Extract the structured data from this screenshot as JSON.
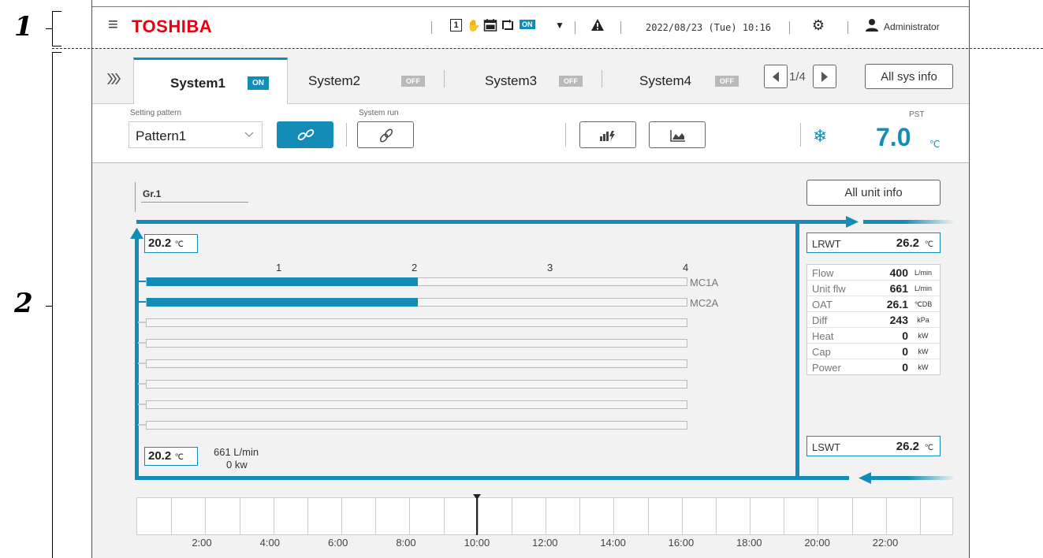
{
  "callouts": {
    "one": "1",
    "two": "2"
  },
  "header": {
    "brand": "TOSHIBA",
    "on_badge": "ON",
    "datetime": "2022/08/23 (Tue) 10:16",
    "user": "Administrator",
    "icons": [
      "menu-icon",
      "schedule-1-icon",
      "hand-icon",
      "calendar-off-icon",
      "cycle-icon",
      "dropdown-icon",
      "warning-icon",
      "gear-icon",
      "user-icon"
    ]
  },
  "tabs": [
    {
      "label": "System1",
      "status": "ON"
    },
    {
      "label": "System2",
      "status": "OFF"
    },
    {
      "label": "System3",
      "status": "OFF"
    },
    {
      "label": "System4",
      "status": "OFF"
    }
  ],
  "pager": {
    "text": "1/4"
  },
  "all_sys_info": "All sys info",
  "toolbar": {
    "setting_pattern_label": "Setting pattern",
    "setting_pattern_value": "Pattern1",
    "system_run_label": "System run",
    "pst_label": "PST",
    "pst_value": "7.0",
    "pst_unit": "℃"
  },
  "group": {
    "title": "Gr.1",
    "all_unit_info": "All unit info",
    "inlet_temp": "20.2",
    "outlet_temp": "20.2",
    "temp_unit": "℃",
    "flow_total": "661 L/min",
    "power_total": "0 kw",
    "scale": [
      "1",
      "2",
      "3",
      "4"
    ],
    "bars": [
      {
        "label": "MC1A",
        "value": 2.0
      },
      {
        "label": "MC2A",
        "value": 2.0
      },
      {
        "label": "",
        "value": 0
      },
      {
        "label": "",
        "value": 0
      },
      {
        "label": "",
        "value": 0
      },
      {
        "label": "",
        "value": 0
      },
      {
        "label": "",
        "value": 0
      },
      {
        "label": "",
        "value": 0
      }
    ],
    "scale_max": 4
  },
  "side": {
    "lrwt": {
      "label": "LRWT",
      "value": "26.2",
      "unit": "℃"
    },
    "lswt": {
      "label": "LSWT",
      "value": "26.2",
      "unit": "℃"
    },
    "rows": [
      {
        "k": "Flow",
        "v": "400",
        "u": "L/min"
      },
      {
        "k": "Unit flw",
        "v": "661",
        "u": "L/min"
      },
      {
        "k": "OAT",
        "v": "26.1",
        "u": "℃DB"
      },
      {
        "k": "Diff",
        "v": "243",
        "u": "kPa"
      },
      {
        "k": "Heat",
        "v": "0",
        "u": "kW"
      },
      {
        "k": "Cap",
        "v": "0",
        "u": "kW"
      },
      {
        "k": "Power",
        "v": "0",
        "u": "kW"
      }
    ]
  },
  "timeline": {
    "labels": [
      "2:00",
      "4:00",
      "6:00",
      "8:00",
      "10:00",
      "12:00",
      "14:00",
      "16:00",
      "18:00",
      "20:00",
      "22:00"
    ],
    "current": "10:00"
  },
  "colors": {
    "accent": "#138db8",
    "brand": "#e60012",
    "off": "#b9b9b9"
  }
}
